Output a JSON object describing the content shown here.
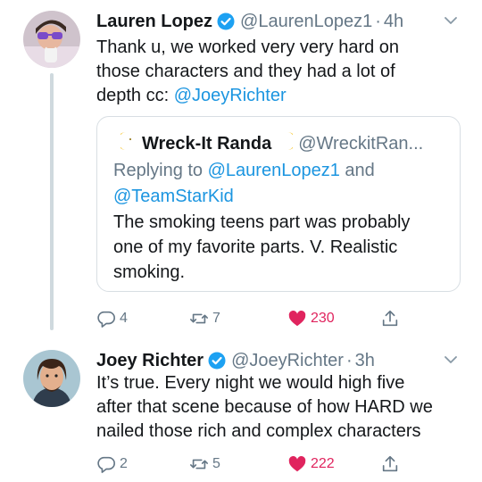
{
  "tweets": [
    {
      "name": "Lauren Lopez",
      "handle": "@LaurenLopez1",
      "separator": "·",
      "time": "4h",
      "text_lines": [
        "Thank u, we worked very very hard on",
        "those characters and they had a lot of"
      ],
      "text_last_prefix": "depth cc: ",
      "text_mention": "@JoeyRichter",
      "quote": {
        "name": "Wreck-It Randa",
        "handle": "@WreckitRan...",
        "reply_prefix": "Replying to ",
        "reply_mention_1": "@LaurenLopez1",
        "reply_and": " and",
        "reply_mention_2": "@TeamStarKid",
        "text_lines": [
          "The smoking teens part was probably",
          "one of my favorite parts. V. Realistic",
          "smoking."
        ]
      },
      "replies": "4",
      "retweets": "7",
      "likes": "230"
    },
    {
      "name": "Joey Richter",
      "handle": "@JoeyRichter",
      "separator": "·",
      "time": "3h",
      "text_lines": [
        "It’s true. Every night we would high five",
        "after that scene because of how HARD we",
        "nailed those rich and complex characters"
      ],
      "replies": "2",
      "retweets": "5",
      "likes": "222"
    }
  ],
  "icons": [
    "verified-badge-icon",
    "chevron-down-icon",
    "reply-icon",
    "retweet-icon",
    "heart-icon",
    "share-icon",
    "moon-icon"
  ],
  "colors": {
    "link": "#1b95e0",
    "secondary_text": "#657786",
    "like": "#e0245e",
    "verified": "#1da1f2",
    "border": "#d8dee3"
  }
}
